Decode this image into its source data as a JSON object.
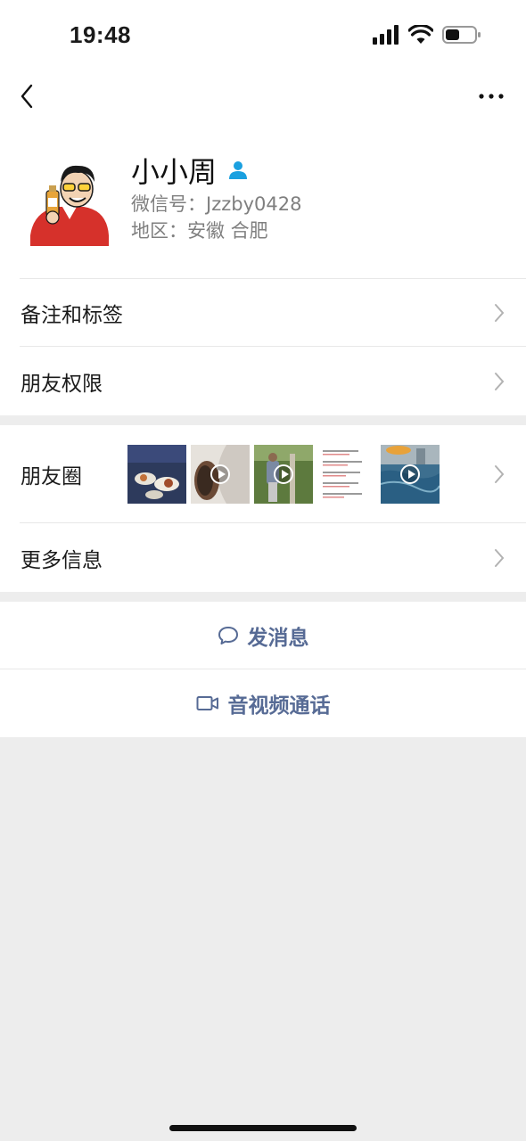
{
  "status_bar": {
    "time": "19:48"
  },
  "profile": {
    "name": "小小周",
    "wechat_id": "微信号：Jzzby0428",
    "region": "地区：安徽 合肥"
  },
  "list1": [
    {
      "label": "备注和标签"
    },
    {
      "label": "朋友权限"
    }
  ],
  "moments": {
    "label": "朋友圈"
  },
  "more_info": {
    "label": "更多信息"
  },
  "actions": {
    "message": "发消息",
    "video_call": "音视频通话"
  },
  "colors": {
    "accent": "#576b95",
    "background": "#ededed",
    "card": "#ffffff",
    "contact_icon": "#1aa0e0"
  }
}
